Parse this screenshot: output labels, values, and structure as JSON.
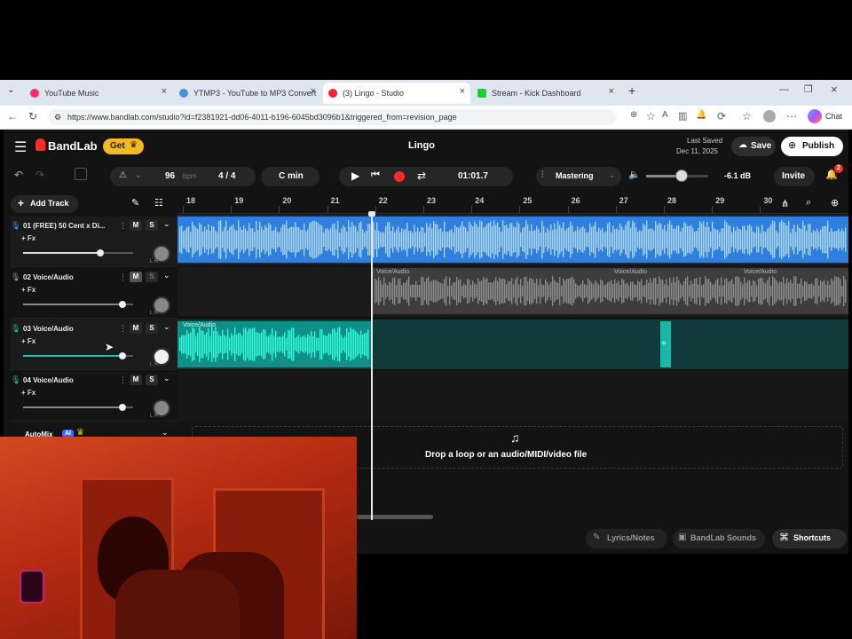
{
  "browser": {
    "tabs": [
      {
        "label": "YouTube Music",
        "color": "#ff2d6f"
      },
      {
        "label": "YTMP3 - YouTube to MP3 Convert",
        "color": "#4a90d9"
      },
      {
        "label": "(3) Lingo - Studio",
        "color": "#ee2233"
      },
      {
        "label": "Stream - Kick Dashboard",
        "color": "#22cc33"
      }
    ],
    "new_tab": "+",
    "url": "https://www.bandlab.com/studio?id=f2381921-dd06-4011-b196-6045bd3096b1&triggered_from=revision_page",
    "profile_label": "Chat"
  },
  "header": {
    "logo": "BandLab",
    "get_label": "Get",
    "project_title": "Lingo",
    "last_saved_label": "Last Saved",
    "last_saved_date": "Dec 11, 2025",
    "save_label": "Save",
    "publish_label": "Publish"
  },
  "toolbar": {
    "tempo": "96",
    "tempo_unit": "bpm",
    "time_signature": "4 / 4",
    "key": "C min",
    "time": "01:01.7",
    "mastering_label": "Mastering",
    "volume_db": "-6.1 dB",
    "volume_level": 0.55,
    "invite_label": "Invite",
    "notification_count": "2"
  },
  "tracks_panel": {
    "add_track_label": "Add Track",
    "fx_label": "+ Fx",
    "mute_label": "M",
    "solo_label": "S",
    "knob_marks": "L R",
    "tracks": [
      {
        "name": "01  (FREE) 50 Cent x Di...",
        "color": "#3a9bff",
        "volume": 0.7
      },
      {
        "name": "02  Voice/Audio",
        "color": "#9a9a9a",
        "volume": 0.9
      },
      {
        "name": "03  Voice/Audio",
        "color": "#19c3b0",
        "volume": 0.9
      },
      {
        "name": "04  Voice/Audio",
        "color": "#19c3b0",
        "volume": 0.9
      }
    ],
    "automix_label": "AutoMix",
    "ai_badge": "AI"
  },
  "timeline": {
    "bars": [
      "18",
      "19",
      "20",
      "21",
      "22",
      "23",
      "24",
      "25",
      "26",
      "27",
      "28",
      "29",
      "30"
    ]
  },
  "clips": {
    "voice_label": "Voice/Audio"
  },
  "dropzone": {
    "text": "Drop a loop or an audio/MIDI/video file"
  },
  "bottom": {
    "lyrics_label": "Lyrics/Notes",
    "sounds_label": "BandLab Sounds",
    "shortcuts_label": "Shortcuts"
  },
  "colors": {
    "accent_blue": "#3a9bff",
    "accent_teal": "#19c3b0",
    "record_red": "#ff2a2a",
    "get_gold": "#f3b922"
  }
}
